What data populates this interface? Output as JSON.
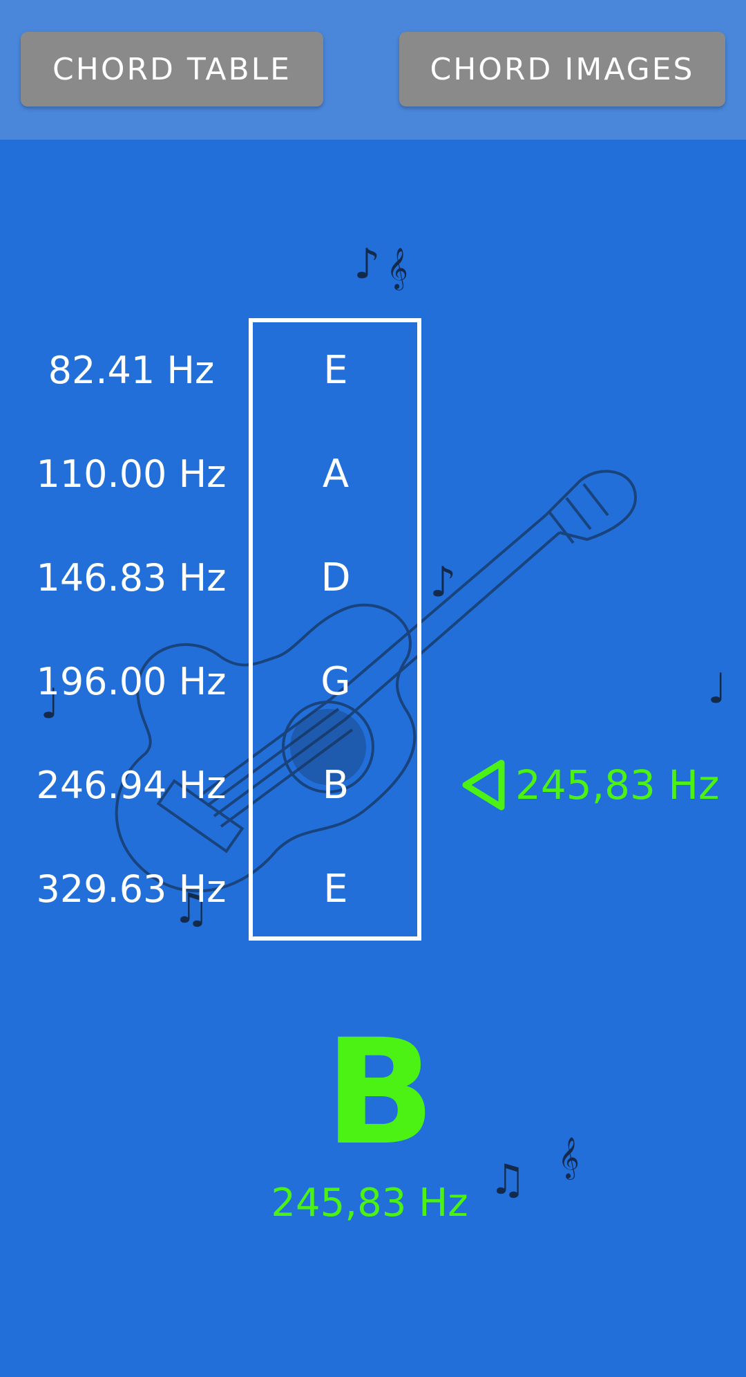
{
  "toolbar": {
    "chord_table_label": "CHORD TABLE",
    "chord_images_label": "CHORD IMAGES"
  },
  "strings": [
    {
      "frequency": "82.41 Hz",
      "note": "E"
    },
    {
      "frequency": "110.00 Hz",
      "note": "A"
    },
    {
      "frequency": "146.83 Hz",
      "note": "D"
    },
    {
      "frequency": "196.00 Hz",
      "note": "G"
    },
    {
      "frequency": "246.94 Hz",
      "note": "B"
    },
    {
      "frequency": "329.63 Hz",
      "note": "E"
    }
  ],
  "detected": {
    "note": "B",
    "frequency": "245,83 Hz",
    "indicator_frequency": "245,83 Hz"
  },
  "colors": {
    "background": "#226fd9",
    "topbar": "#4a87db",
    "button": "#8a8a8a",
    "accent_green": "#4cf213"
  },
  "icons": {
    "decorative_notes": [
      "eighth-note-icon",
      "treble-clef-icon",
      "quarter-note-icon",
      "beamed-notes-icon",
      "guitar-sketch-icon"
    ]
  }
}
